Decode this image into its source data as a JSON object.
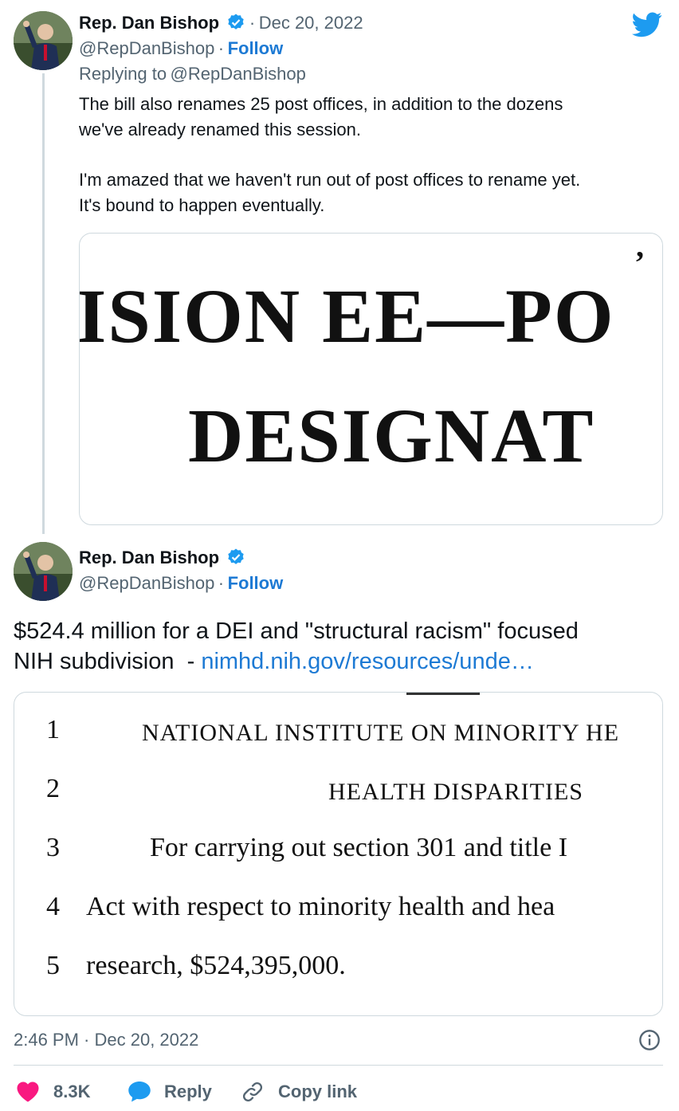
{
  "twitter_icon": "twitter-bird-icon",
  "colors": {
    "accent": "#1d9bf0",
    "link": "#1d7ad4",
    "heart": "#f91880",
    "muted": "#536471"
  },
  "parent_tweet": {
    "author_name": "Rep. Dan Bishop",
    "separator": "·",
    "date": "Dec 20, 2022",
    "handle": "@RepDanBishop",
    "follow_sep": "·",
    "follow_label": "Follow",
    "replying_prefix": "Replying to",
    "replying_to": "@RepDanBishop",
    "text_line_1": "The bill also renames 25 post offices, in addition to the dozens",
    "text_line_2": "we've already renamed this session.",
    "text_line_3": "I'm amazed that we haven't run out of post offices to rename yet.",
    "text_line_4": "It's bound to happen eventually.",
    "image_text_1": "ISION EE—PO",
    "image_text_2": "DESIGNAT"
  },
  "main_tweet": {
    "author_name": "Rep. Dan Bishop",
    "handle": "@RepDanBishop",
    "follow_sep": "·",
    "follow_label": "Follow",
    "text_line_1": "$524.4 million for a DEI and \"structural racism\" focused",
    "text_line_2_prefix": "NIH subdivision  - ",
    "link": "nimhd.nih.gov/resources/unde…",
    "document_lines": [
      {
        "num": "1",
        "text": "NATIONAL INSTITUTE ON MINORITY HE"
      },
      {
        "num": "2",
        "text": "HEALTH DISPARITIES"
      },
      {
        "num": "3",
        "text": "For carrying out section 301 and title I"
      },
      {
        "num": "4",
        "text": "Act with respect to minority health and hea"
      },
      {
        "num": "5",
        "text": "research, $524,395,000."
      }
    ],
    "timestamp": "2:46 PM · Dec 20, 2022",
    "info_icon": "info-icon"
  },
  "actions": {
    "like_count": "8.3K",
    "reply_label": "Reply",
    "copy_label": "Copy link"
  }
}
